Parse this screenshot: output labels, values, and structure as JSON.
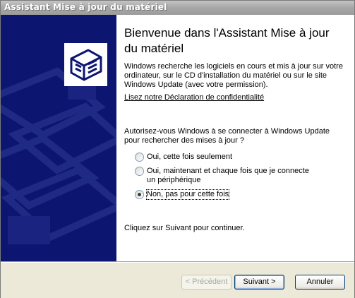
{
  "window": {
    "title": "Assistant Mise à jour du matériel"
  },
  "sidebar": {
    "icon": "hardware-box-icon"
  },
  "main": {
    "heading": "Bienvenue dans l'Assistant Mise à jour du matériel",
    "intro": "Windows recherche les logiciels en cours et mis à jour sur votre ordinateur, sur le CD d'installation du matériel ou sur le site Windows Update (avec votre permission).",
    "privacy_link": "Lisez notre Déclaration de confidentialité",
    "question": "Autorisez-vous Windows à se connecter à Windows Update pour rechercher des mises à jour ?",
    "options": [
      {
        "label": "Oui, cette fois seulement",
        "checked": false
      },
      {
        "label": "Oui, maintenant et chaque fois que je connecte un périphérique",
        "checked": false
      },
      {
        "label": "Non, pas pour cette fois",
        "checked": true
      }
    ],
    "continue_text": "Cliquez sur Suivant pour continuer."
  },
  "footer": {
    "back_label": "< Précédent",
    "next_label": "Suivant >",
    "cancel_label": "Annuler"
  }
}
